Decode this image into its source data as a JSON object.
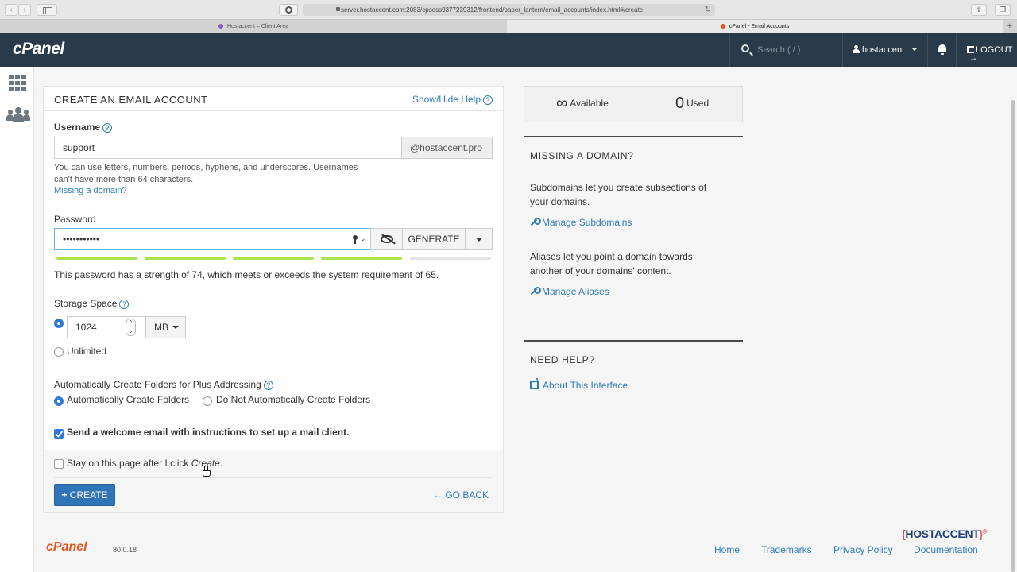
{
  "browser": {
    "url": "server.hostaccent.com:2083/cpsess9377239312/frontend/paper_lantern/email_accounts/index.html#/create",
    "tabs": [
      {
        "label": "Hostaccent – Client Area",
        "active": false,
        "favicon_color": "#8a5cc4"
      },
      {
        "label": "cPanel - Email Accounts",
        "active": true,
        "favicon_color": "#e8531f"
      }
    ]
  },
  "header": {
    "logo": "cPanel",
    "search_placeholder": "Search ( / )",
    "username": "hostaccent",
    "logout_label": "LOGOUT"
  },
  "form": {
    "title": "CREATE AN EMAIL ACCOUNT",
    "help_link": "Show/Hide Help",
    "username_label": "Username",
    "username_value": "support",
    "domain": "@hostaccent.pro",
    "username_hint_1": "You can use letters, numbers, periods, hyphens, and underscores. Usernames",
    "username_hint_2": "can't have more than 64 characters.",
    "missing_domain_link": "Missing a domain?",
    "password_label": "Password",
    "password_value": "•••••••••••",
    "generate_label": "GENERATE",
    "strength_segments_filled": 4,
    "strength_segments_total": 5,
    "strength_text": "This password has a strength of 74, which meets or exceeds the system requirement of 65.",
    "storage_label": "Storage Space",
    "storage_value": "1024",
    "storage_unit": "MB",
    "unlimited_label": "Unlimited",
    "storage_selected": "custom",
    "plus_label": "Automatically Create Folders for Plus Addressing",
    "plus_auto": "Automatically Create Folders",
    "plus_no_auto": "Do Not Automatically Create Folders",
    "plus_selected": "auto",
    "welcome_label": "Send a welcome email with instructions to set up a mail client.",
    "welcome_checked": true,
    "stay_prefix": "Stay on this page after I click ",
    "stay_em": "Create",
    "stay_suffix": ".",
    "stay_checked": false,
    "create_label": "CREATE",
    "go_back_label": "GO BACK"
  },
  "stats": {
    "available_value": "∞",
    "available_label": "Available",
    "used_value": "0",
    "used_label": "Used"
  },
  "sidebar_right": {
    "missing_heading": "MISSING A DOMAIN?",
    "subdomains_text_1": "Subdomains let you create subsections of",
    "subdomains_text_2": "your domains.",
    "manage_subdomains": "Manage Subdomains",
    "aliases_text_1": "Aliases let you point a domain towards",
    "aliases_text_2": "another of your domains' content.",
    "manage_aliases": "Manage Aliases",
    "help_heading": "NEED HELP?",
    "about_link": "About This Interface"
  },
  "footer": {
    "logo": "cPanel",
    "version": "80.0.18",
    "links": [
      "Home",
      "Trademarks",
      "Privacy Policy",
      "Documentation"
    ],
    "brand_open": "{",
    "brand": "HOSTACCENT",
    "brand_close": "}",
    "brand_mark": "®"
  }
}
